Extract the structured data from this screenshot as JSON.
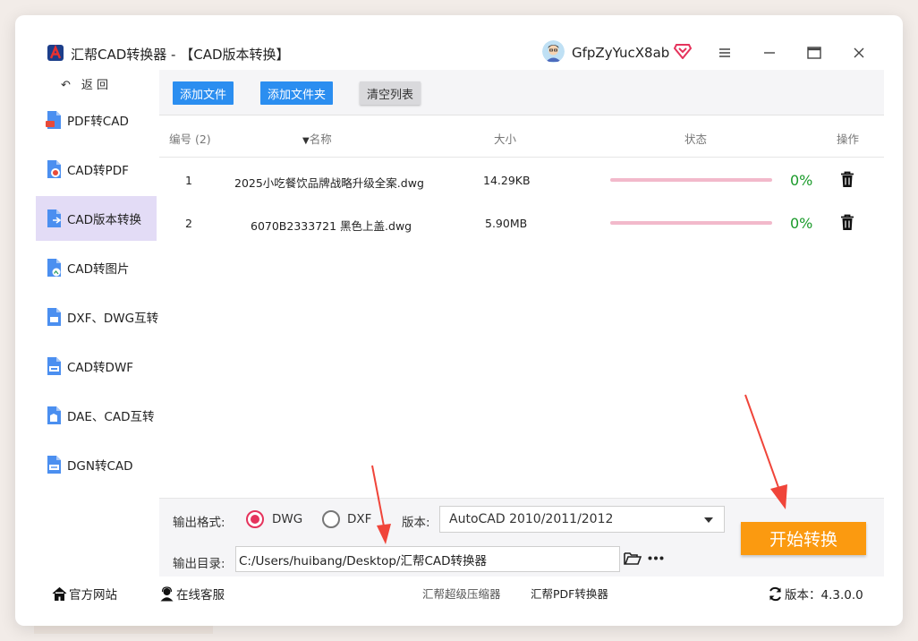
{
  "window": {
    "title": "汇帮CAD转换器 - 【CAD版本转换】",
    "username": "GfpZyYucX8ab"
  },
  "sidebar": {
    "back_label": "返 回",
    "items": [
      {
        "label": "PDF转CAD",
        "icon": "pdf-to-cad-icon"
      },
      {
        "label": "CAD转PDF",
        "icon": "cad-to-pdf-icon"
      },
      {
        "label": "CAD版本转换",
        "icon": "cad-version-icon",
        "active": true
      },
      {
        "label": "CAD转图片",
        "icon": "cad-to-image-icon"
      },
      {
        "label": "DXF、DWG互转",
        "icon": "dxf-dwg-icon"
      },
      {
        "label": "CAD转DWF",
        "icon": "cad-to-dwf-icon"
      },
      {
        "label": "DAE、CAD互转",
        "icon": "dae-cad-icon"
      },
      {
        "label": "DGN转CAD",
        "icon": "dgn-to-cad-icon"
      }
    ]
  },
  "toolbar": {
    "add_file": "添加文件",
    "add_folder": "添加文件夹",
    "clear_list": "清空列表"
  },
  "table": {
    "headers": {
      "index": "编号 (2)",
      "name": "名称",
      "size": "大小",
      "status": "状态",
      "action": "操作"
    },
    "rows": [
      {
        "index": "1",
        "name": "2025小吃餐饮品牌战略升级全案.dwg",
        "size": "14.29KB",
        "progress": 0,
        "percent": "0%"
      },
      {
        "index": "2",
        "name": "6070B2333721 黑色上盖.dwg",
        "size": "5.90MB",
        "progress": 0,
        "percent": "0%"
      }
    ]
  },
  "output": {
    "format_label": "输出格式:",
    "format_options": [
      "DWG",
      "DXF"
    ],
    "format_selected": "DWG",
    "version_label": "版本:",
    "version_value": "AutoCAD 2010/2011/2012",
    "dir_label": "输出目录:",
    "dir_value": "C:/Users/huibang/Desktop/汇帮CAD转换器",
    "start_label": "开始转换"
  },
  "footer": {
    "website": "官方网站",
    "support": "在线客服",
    "link1": "汇帮超级压缩器",
    "link2": "汇帮PDF转换器",
    "version": "版本：4.3.0.0"
  },
  "colors": {
    "accent_blue": "#2b8ef0",
    "start_orange": "#fb9a10",
    "active_sidebar": "#e3dcf6",
    "radio_red": "#e5335c",
    "percent_green": "#1a9a2a",
    "progress_pink": "#f2b9cb"
  }
}
